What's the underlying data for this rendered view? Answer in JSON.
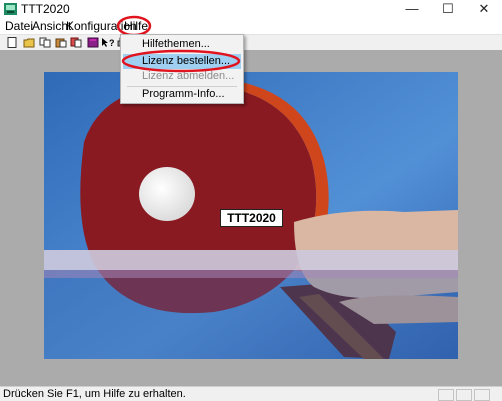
{
  "window": {
    "title": "TTT2020",
    "minimize_glyph": "—",
    "maximize_glyph": "☐",
    "close_glyph": "✕"
  },
  "menubar": {
    "items": [
      "Datei",
      "Ansicht",
      "Konfiguration",
      "Hilfe"
    ],
    "open_menu": "Hilfe"
  },
  "help_menu": {
    "items": [
      {
        "label": "Hilfethemen...",
        "state": "normal"
      },
      {
        "label": "Lizenz bestellen...",
        "state": "highlighted"
      },
      {
        "label": "Lizenz abmelden...",
        "state": "disabled"
      },
      {
        "label": "Programm-Info...",
        "state": "normal"
      }
    ]
  },
  "toolbar": {
    "icons": [
      "new-file-icon",
      "open-folder-icon",
      "copy-icon",
      "paste-icon",
      "cut-icon",
      "book-icon",
      "context-help-icon",
      "print-icon"
    ]
  },
  "document": {
    "image_caption": "TTT2020"
  },
  "statusbar": {
    "text": "Drücken Sie F1, um Hilfe zu erhalten."
  },
  "colors": {
    "accent_highlight": "#9fd0f2",
    "annotation_red": "#e0141e",
    "client_bg": "#ababab"
  }
}
